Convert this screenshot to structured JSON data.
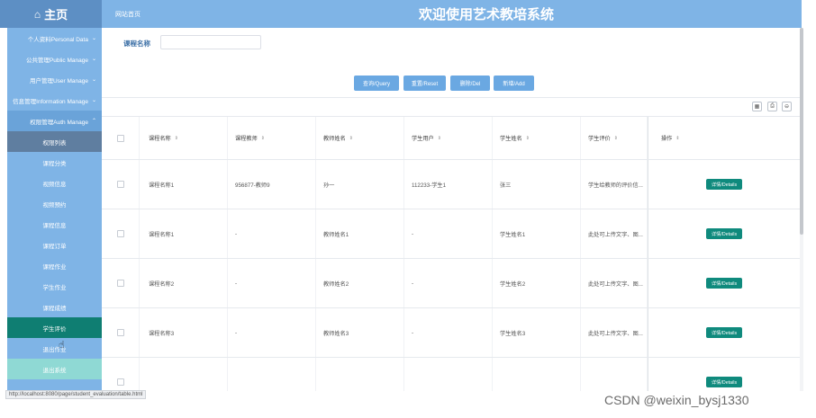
{
  "header": {
    "home_label": "主页",
    "home_icon": "home-icon",
    "site_home": "网站首页",
    "title": "欢迎使用艺术教培系统"
  },
  "sidebar": {
    "groups": [
      {
        "label": "个人资料Personal Data"
      },
      {
        "label": "公共管理Public Manage"
      },
      {
        "label": "用户管理User Manage"
      },
      {
        "label": "信息管理Information Manage"
      },
      {
        "label": "权限管理Auth Manage"
      }
    ],
    "items": [
      {
        "label": "权限列表"
      },
      {
        "label": "课程分类"
      },
      {
        "label": "视频信息"
      },
      {
        "label": "视频预约"
      },
      {
        "label": "课程信息"
      },
      {
        "label": "课程订单"
      },
      {
        "label": "课程作业"
      },
      {
        "label": "学生作业"
      },
      {
        "label": "课程成绩"
      },
      {
        "label": "学生评价"
      },
      {
        "label": "退出作业"
      },
      {
        "label": "退出系统"
      }
    ]
  },
  "status_url": "http://localhost:8080/page/student_evaluation/table.html",
  "search": {
    "label": "课程名称",
    "value": ""
  },
  "buttons": {
    "query": "查询/Query",
    "reset": "重置/Reset",
    "del": "删除/Del",
    "add": "新增/Add"
  },
  "tools": {
    "filter": "▦",
    "print": "⎙",
    "export": "⊖"
  },
  "table": {
    "headers": [
      "课程名称",
      "课程教师",
      "教师姓名",
      "学生用户",
      "学生姓名",
      "学生评价",
      "操作"
    ],
    "rows": [
      {
        "c1": "课程名称1",
        "c2": "956877-教师9",
        "c3": "孙一",
        "c4": "112233-学生1",
        "c5": "张三",
        "c6": "学生给教师的评价信...",
        "action": "详情/Details"
      },
      {
        "c1": "课程名称1",
        "c2": "-",
        "c3": "教师姓名1",
        "c4": "-",
        "c5": "学生姓名1",
        "c6": "此处可上传文字、图...",
        "action": "详情/Details"
      },
      {
        "c1": "课程名称2",
        "c2": "-",
        "c3": "教师姓名2",
        "c4": "-",
        "c5": "学生姓名2",
        "c6": "此处可上传文字、图...",
        "action": "详情/Details"
      },
      {
        "c1": "课程名称3",
        "c2": "-",
        "c3": "教师姓名3",
        "c4": "-",
        "c5": "学生姓名3",
        "c6": "此处可上传文字、图...",
        "action": "详情/Details"
      },
      {
        "c1": "",
        "c2": "",
        "c3": "",
        "c4": "",
        "c5": "",
        "c6": "",
        "action": "详情/Details"
      }
    ]
  },
  "watermark": "CSDN @weixin_bysj1330",
  "colors": {
    "header": "#7fb4e6",
    "selected": "#0f7e72",
    "button": "#6aa8e2",
    "detail": "#0f8a7d"
  }
}
